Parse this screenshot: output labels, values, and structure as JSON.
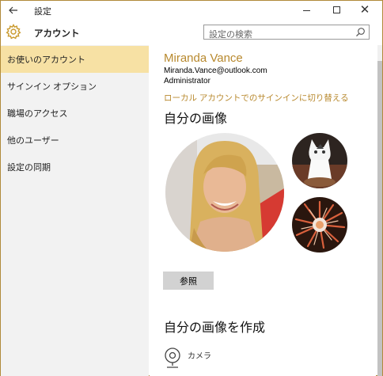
{
  "window": {
    "title": "設定"
  },
  "header": {
    "section_title": "アカウント",
    "search_placeholder": "設定の検索"
  },
  "sidebar": {
    "items": [
      {
        "label": "お使いのアカウント",
        "active": true
      },
      {
        "label": "サインイン オプション",
        "active": false
      },
      {
        "label": "職場のアクセス",
        "active": false
      },
      {
        "label": "他のユーザー",
        "active": false
      },
      {
        "label": "設定の同期",
        "active": false
      }
    ]
  },
  "account": {
    "name": "Miranda Vance",
    "email": "Miranda.Vance@outlook.com",
    "role": "Administrator",
    "switch_link": "ローカル アカウントでのサインインに切り替える"
  },
  "picture": {
    "heading": "自分の画像",
    "browse_label": "参照"
  },
  "create": {
    "heading": "自分の画像を作成",
    "camera_label": "カメラ"
  },
  "colors": {
    "accent": "#b8892e",
    "active_bg": "#f7e1a4",
    "sidebar_bg": "#f2f2f2"
  },
  "icons": [
    "back-arrow-icon",
    "gear-icon",
    "search-icon",
    "minimize-icon",
    "maximize-icon",
    "close-icon",
    "camera-icon"
  ]
}
